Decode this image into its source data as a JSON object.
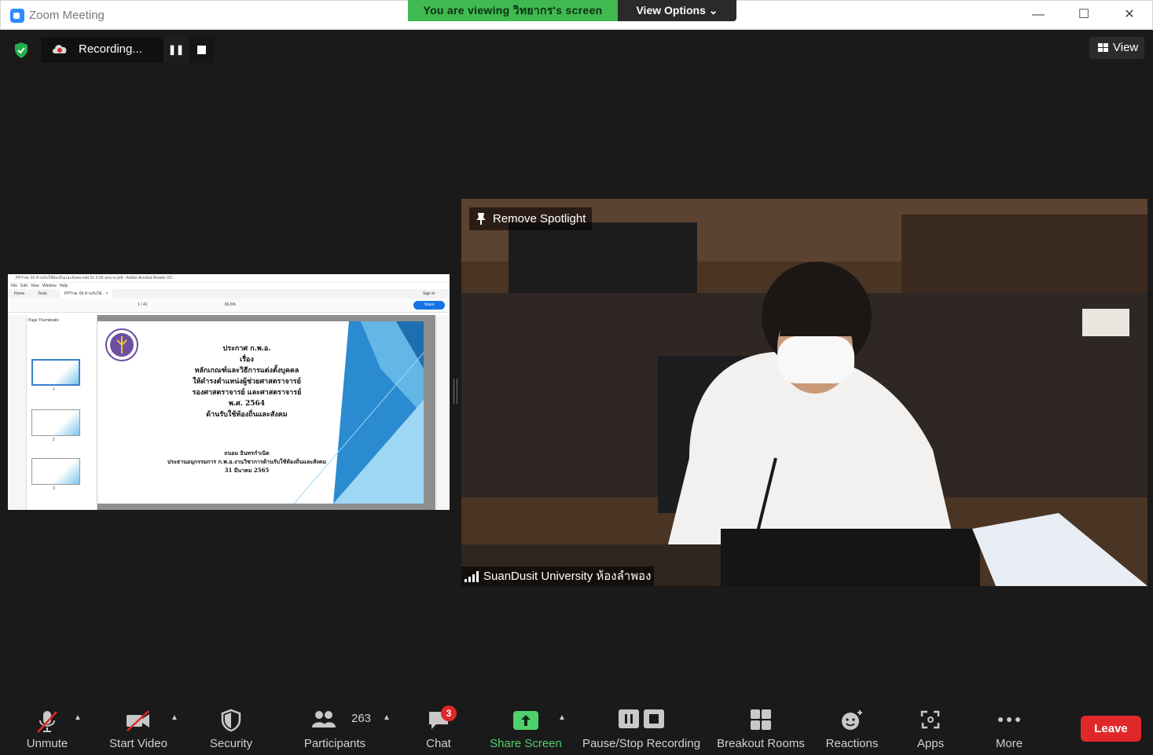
{
  "window": {
    "title": "Zoom Meeting",
    "viewing_banner": "You are viewing วิทยากร's screen",
    "view_options": "View Options ⌄",
    "minimize": "—",
    "maximize": "☐",
    "close": "✕"
  },
  "recording": {
    "label": "Recording...",
    "pause": "❚❚"
  },
  "view_button": {
    "label": "View"
  },
  "shared_screen": {
    "app_title": "PPTกพ. 65 ด้านรับใช้ท้องถิ่นและสังคม-edit 31-3-65 ลงนาม.pdf - Adobe Acrobat Reader DC",
    "menu": [
      "File",
      "Edit",
      "View",
      "Window",
      "Help"
    ],
    "tabs": [
      "Home",
      "Tools",
      "PPTกพ. 65 ด้านรับใช้... ×"
    ],
    "sign_in": "Sign In",
    "share": "Share",
    "page_indicator": "1 / 41",
    "zoom_level": "66.6%",
    "thumbnails_header": "Page Thumbnails",
    "thumb_numbers": [
      "1",
      "2",
      "3"
    ],
    "slide": {
      "lines": [
        "ประกาศ ก.พ.อ.",
        "เรื่อง",
        "หลักเกณฑ์และวิธีการแต่งตั้งบุคคล",
        "ให้ดำรงตำแหน่งผู้ช่วยศาสตราจารย์",
        "รองศาสตราจารย์ และศาสตราจารย์",
        "พ.ศ. 2564",
        "ด้านรับใช้ท้องถิ่นและสังคม"
      ],
      "author": "ถนอม อินทรกำเนิด",
      "position": "ประธานอนุกรรมการ ก.พ.อ.งานวิชาการด้านรับใช้ท้องถิ่นและสังคม",
      "date": "31 มีนาคม 2565"
    }
  },
  "spotlight": {
    "remove_label": "Remove Spotlight",
    "participant_name": "SuanDusit University ห้องลำพอง"
  },
  "toolbar": {
    "unmute": "Unmute",
    "start_video": "Start Video",
    "security": "Security",
    "participants": "Participants",
    "participants_count": "263",
    "chat": "Chat",
    "chat_badge": "3",
    "share_screen": "Share Screen",
    "recording": "Pause/Stop Recording",
    "breakout": "Breakout Rooms",
    "reactions": "Reactions",
    "apps": "Apps",
    "more": "More",
    "leave": "Leave"
  },
  "colors": {
    "banner_green": "#3fb950",
    "share_green": "#4fd16b",
    "leave_red": "#e02828",
    "toolbar_bg": "#1a1a1a"
  }
}
